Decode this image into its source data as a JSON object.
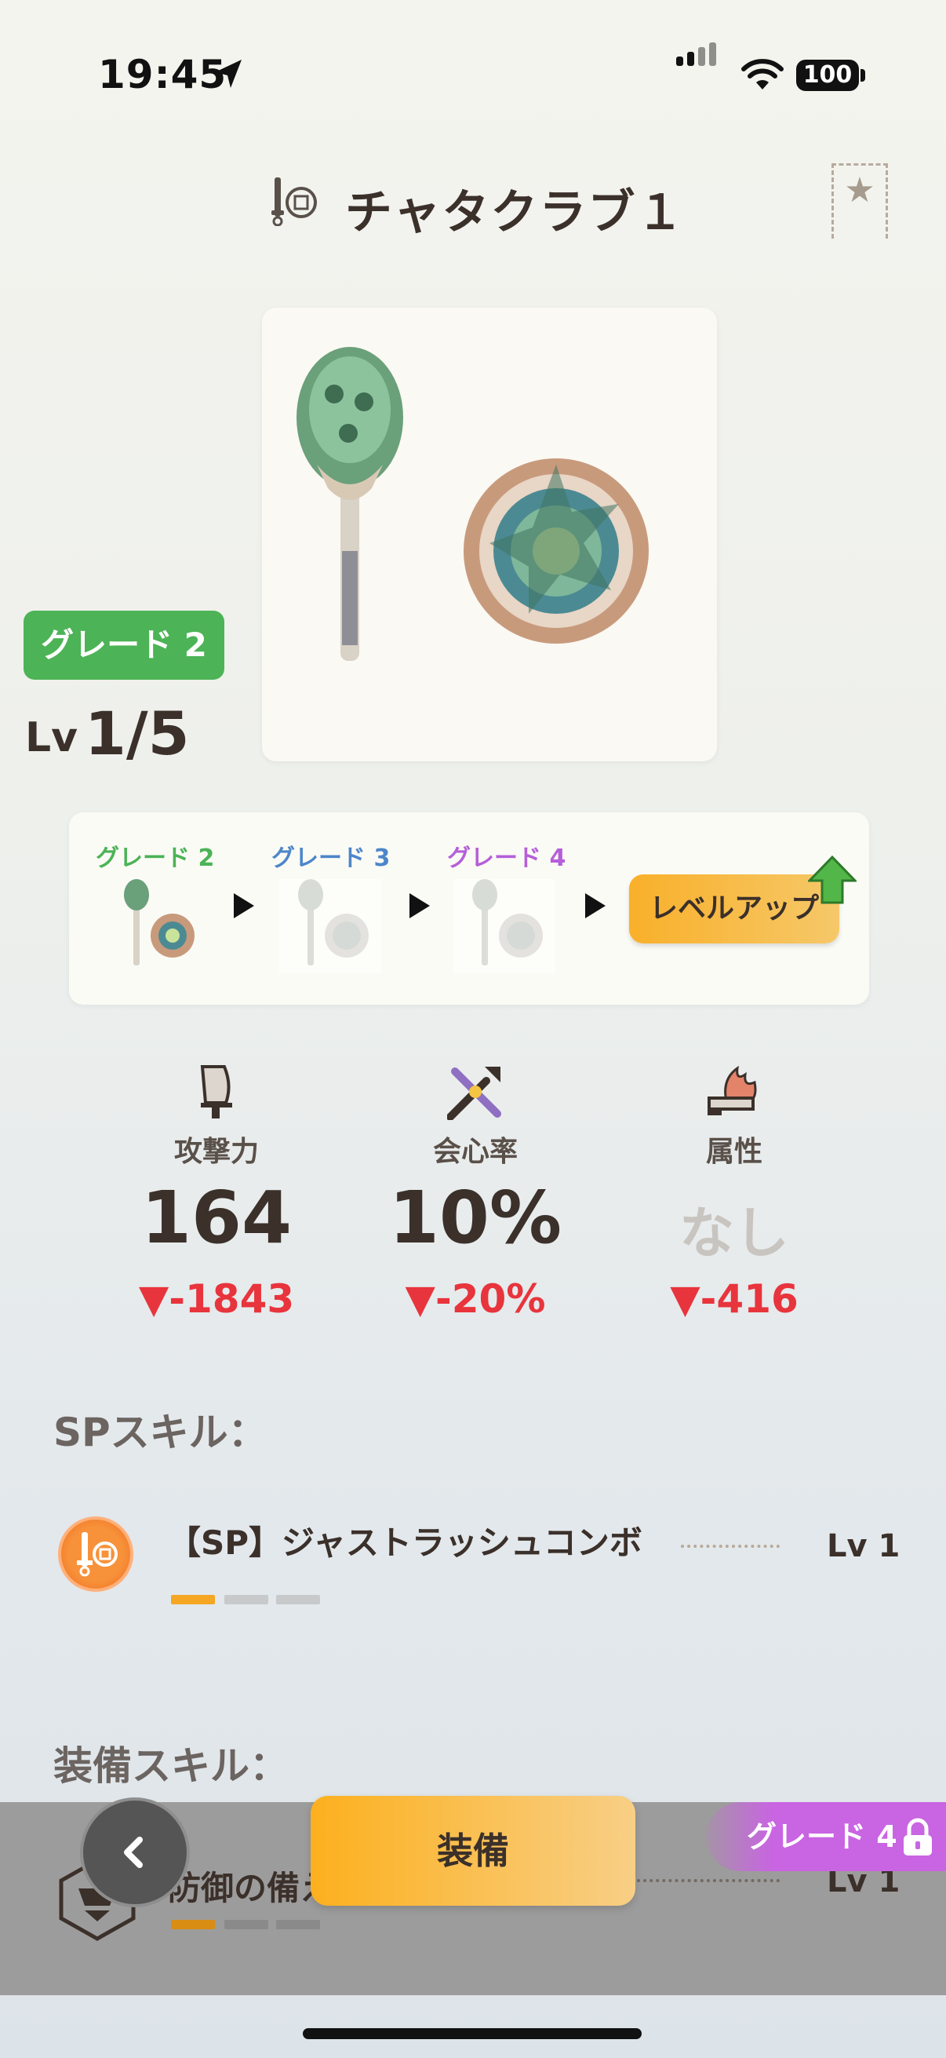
{
  "status_bar": {
    "time": "19:45",
    "battery": "100"
  },
  "header": {
    "title": "チャタクラブ１"
  },
  "weapon": {
    "grade": "グレード 2",
    "lv_label": "Lv",
    "lv_value": "1/5"
  },
  "upgrade_path": {
    "grades": [
      {
        "label": "グレード 2",
        "color": "#4cb356"
      },
      {
        "label": "グレード 3",
        "color": "#4d86c9"
      },
      {
        "label": "グレード 4",
        "color": "#b55fd9"
      }
    ],
    "level_up_label": "レベルアップ"
  },
  "stats": [
    {
      "icon": "sword-icon",
      "label": "攻撃力",
      "value": "164",
      "delta": "▼-1843"
    },
    {
      "icon": "crit-icon",
      "label": "会心率",
      "value": "10%",
      "delta": "▼-20%"
    },
    {
      "icon": "element-icon",
      "label": "属性",
      "value": "なし",
      "delta": "▼-416"
    }
  ],
  "sp_skills": {
    "title": "SPスキル：",
    "items": [
      {
        "name": "【SP】ジャストラッシュコンボ",
        "level": "Lv 1",
        "progress": "1/3"
      }
    ]
  },
  "equip_skills": {
    "title": "装備スキル：",
    "items": [
      {
        "name": "防御の備え",
        "level": "Lv 1",
        "progress": "1/3"
      }
    ]
  },
  "bottom": {
    "equip_label": "装備",
    "grade_tab": "グレード 4"
  },
  "colors": {
    "accent": "#f9b02a",
    "grade2": "#4cb356",
    "delta": "#e8343c",
    "grade4": "#c964e2"
  }
}
